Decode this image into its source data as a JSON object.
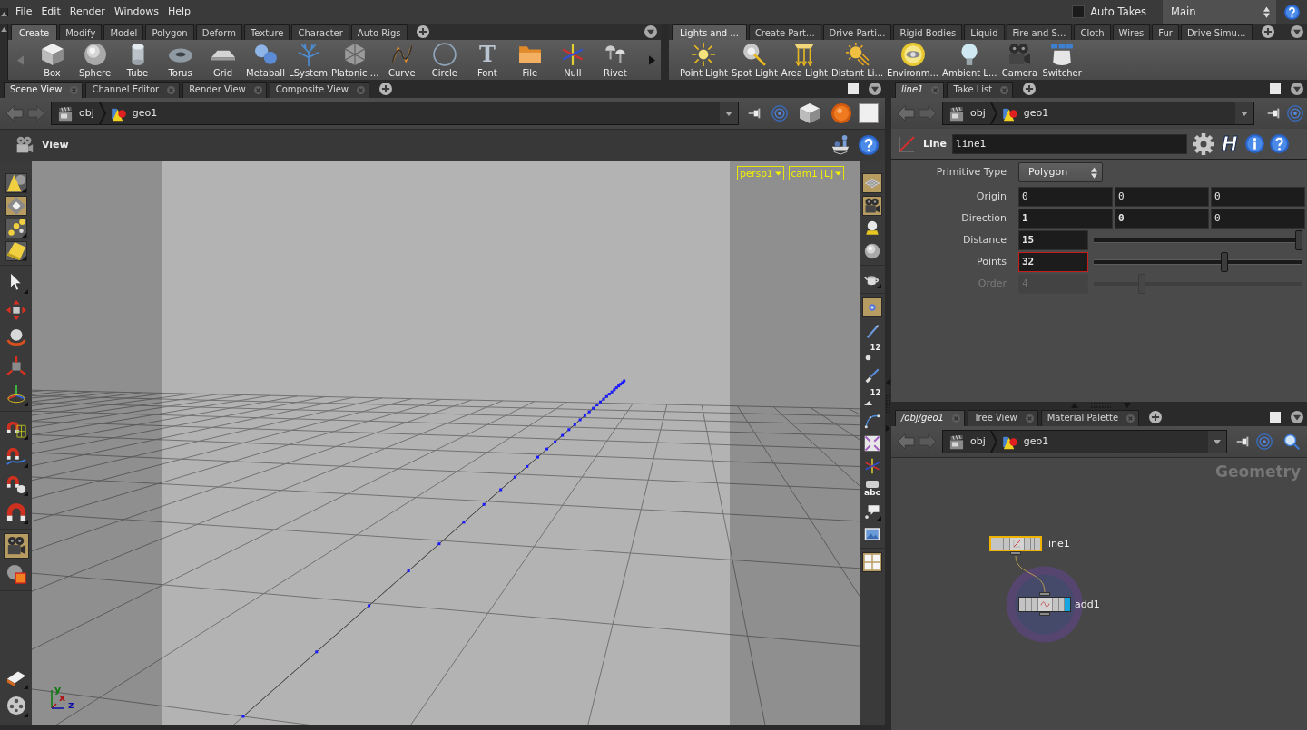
{
  "menu_bar": {
    "items": [
      "File",
      "Edit",
      "Render",
      "Windows",
      "Help"
    ],
    "auto_takes": {
      "label": "Auto Takes",
      "checked": false
    },
    "take": "Main"
  },
  "shelves": [
    {
      "scrollable": true,
      "tabs": [
        {
          "label": "Create",
          "selected": true
        },
        {
          "label": "Modify",
          "selected": false
        },
        {
          "label": "Model",
          "selected": false
        },
        {
          "label": "Polygon",
          "selected": false
        },
        {
          "label": "Deform",
          "selected": false
        },
        {
          "label": "Texture",
          "selected": false
        },
        {
          "label": "Character",
          "selected": false
        },
        {
          "label": "Auto Rigs",
          "selected": false
        }
      ],
      "tools": [
        {
          "label": "Box",
          "kind": "cube"
        },
        {
          "label": "Sphere",
          "kind": "sphere"
        },
        {
          "label": "Tube",
          "kind": "cylinder"
        },
        {
          "label": "Torus",
          "kind": "torus"
        },
        {
          "label": "Grid",
          "kind": "plane"
        },
        {
          "label": "Metaball",
          "kind": "blobs"
        },
        {
          "label": "LSystem",
          "kind": "tree"
        },
        {
          "label": "Platonic ...",
          "kind": "polyhedron"
        },
        {
          "label": "Curve",
          "kind": "curve"
        },
        {
          "label": "Circle",
          "kind": "ring"
        },
        {
          "label": "Font",
          "kind": "glyph",
          "glyph": "T"
        },
        {
          "label": "File",
          "kind": "folder"
        },
        {
          "label": "Null",
          "kind": "axes"
        },
        {
          "label": "Rivet",
          "kind": "bolts"
        }
      ]
    },
    {
      "scrollable": false,
      "tabs": [
        {
          "label": "Lights and ...",
          "selected": true
        },
        {
          "label": "Create Part...",
          "selected": false
        },
        {
          "label": "Drive Parti...",
          "selected": false
        },
        {
          "label": "Rigid Bodies",
          "selected": false
        },
        {
          "label": "Liquid",
          "selected": false
        },
        {
          "label": "Fire and S...",
          "selected": false
        },
        {
          "label": "Cloth",
          "selected": false
        },
        {
          "label": "Wires",
          "selected": false
        },
        {
          "label": "Fur",
          "selected": false
        },
        {
          "label": "Drive Simu...",
          "selected": false
        }
      ],
      "tools": [
        {
          "label": "Point Light",
          "kind": "starburst"
        },
        {
          "label": "Spot Light",
          "kind": "spotlight"
        },
        {
          "label": "Area Light",
          "kind": "panel"
        },
        {
          "label": "Distant Li...",
          "kind": "sun"
        },
        {
          "label": "Environm...",
          "kind": "disc"
        },
        {
          "label": "Ambient L...",
          "kind": "bulb"
        },
        {
          "label": "Camera",
          "kind": "camera"
        },
        {
          "label": "Switcher",
          "kind": "screens"
        }
      ]
    }
  ],
  "scene_view": {
    "tabs": [
      {
        "label": "Scene View",
        "selected": true,
        "linked": false
      },
      {
        "label": "Channel Editor",
        "selected": false,
        "linked": false
      },
      {
        "label": "Render View",
        "selected": false,
        "linked": false
      },
      {
        "label": "Composite View",
        "selected": false,
        "linked": false
      }
    ],
    "path": [
      {
        "label": "obj",
        "kind": "network"
      },
      {
        "label": "geo1",
        "kind": "geometry"
      }
    ],
    "title": "View",
    "camera_menus": [
      "persp1",
      "cam1 [L]"
    ],
    "left_toolbar": [
      {
        "boxed": true,
        "tools": [
          {
            "kind": "cone",
            "selected": false,
            "has_menu": true
          },
          {
            "kind": "diamond",
            "selected": true,
            "has_menu": false
          },
          {
            "kind": "dots",
            "selected": false,
            "has_menu": true
          },
          {
            "kind": "block",
            "selected": false,
            "has_menu": true
          }
        ]
      },
      {
        "boxed": false,
        "tools": [
          {
            "kind": "arrow",
            "selected": false,
            "has_menu": true
          },
          {
            "kind": "move",
            "selected": false,
            "has_menu": false
          },
          {
            "kind": "rotate",
            "selected": false,
            "has_menu": false
          },
          {
            "kind": "scale",
            "selected": false,
            "has_menu": false
          },
          {
            "kind": "handle",
            "selected": false,
            "has_menu": true
          }
        ]
      },
      {
        "boxed": false,
        "tools": [
          {
            "kind": "snapgrid",
            "selected": false,
            "has_menu": true
          },
          {
            "kind": "snapcurve",
            "selected": false,
            "has_menu": true
          },
          {
            "kind": "snappoint",
            "selected": false,
            "has_menu": true
          },
          {
            "kind": "magnet",
            "selected": false,
            "has_menu": true
          }
        ]
      },
      {
        "boxed": false,
        "tools": [
          {
            "kind": "camera",
            "selected": true,
            "has_menu": false
          },
          {
            "kind": "render",
            "selected": false,
            "has_menu": false
          }
        ]
      },
      {
        "boxed": false,
        "tools": [
          {
            "kind": "notes",
            "selected": false,
            "has_menu": true
          },
          {
            "kind": "reel",
            "selected": false,
            "has_menu": true
          }
        ]
      }
    ],
    "right_toolbar": [
      {
        "boxed": false,
        "tools": [
          {
            "kind": "gridplane",
            "selected": true,
            "has_menu": false
          },
          {
            "kind": "camera",
            "selected": true,
            "has_menu": false
          },
          {
            "kind": "lamp",
            "selected": false,
            "has_menu": false
          },
          {
            "kind": "sphere",
            "selected": false,
            "has_menu": false
          }
        ]
      },
      {
        "boxed": false,
        "tools": [
          {
            "kind": "teapot",
            "selected": false,
            "has_menu": true
          }
        ]
      },
      {
        "boxed": false,
        "tools": [
          {
            "kind": "dot",
            "selected": true,
            "has_menu": false
          },
          {
            "kind": "pen",
            "selected": false,
            "has_menu": false
          },
          {
            "kind": "pointnum",
            "caption": "12",
            "selected": false,
            "has_menu": false
          },
          {
            "kind": "brush",
            "selected": false,
            "has_menu": false
          },
          {
            "kind": "primnum",
            "caption": "12",
            "selected": false,
            "has_menu": false
          },
          {
            "kind": "bezier",
            "selected": false,
            "has_menu": false
          },
          {
            "kind": "shrink",
            "selected": false,
            "has_menu": false
          },
          {
            "kind": "axes",
            "selected": false,
            "has_menu": false
          },
          {
            "kind": "label",
            "caption": "abc",
            "selected": false,
            "has_menu": false
          },
          {
            "kind": "bubble",
            "selected": false,
            "has_menu": true
          },
          {
            "kind": "picture",
            "selected": false,
            "has_menu": false
          }
        ]
      },
      {
        "boxed": false,
        "tools": [
          {
            "kind": "tiles",
            "selected": true,
            "has_menu": false
          }
        ]
      }
    ],
    "axes": [
      {
        "label": "y",
        "color": "#0a780a"
      },
      {
        "label": "x",
        "color": "#b00c0c"
      },
      {
        "label": "z",
        "color": "#0c0ca8"
      }
    ]
  },
  "parameters": {
    "tabs": [
      {
        "label": "line1",
        "selected": true,
        "linked": true
      },
      {
        "label": "Take List",
        "selected": false,
        "linked": false
      }
    ],
    "path": [
      {
        "label": "obj",
        "kind": "network"
      },
      {
        "label": "geo1",
        "kind": "geometry"
      }
    ],
    "node_type": "Line",
    "node_name": "line1",
    "script_button": "H",
    "fields": [
      {
        "kind": "menu",
        "label": "Primitive Type",
        "value": "Polygon",
        "focused": false,
        "disabled": false
      },
      {
        "kind": "vector",
        "label": "Origin",
        "values": [
          {
            "text": "0",
            "changed": false
          },
          {
            "text": "0",
            "changed": false
          },
          {
            "text": "0",
            "changed": false
          }
        ],
        "focused": false,
        "disabled": false
      },
      {
        "kind": "vector",
        "label": "Direction",
        "values": [
          {
            "text": "1",
            "changed": true
          },
          {
            "text": "0",
            "changed": true
          },
          {
            "text": "0",
            "changed": false
          }
        ],
        "focused": false,
        "disabled": false
      },
      {
        "kind": "slider",
        "label": "Distance",
        "value": "15",
        "changed": true,
        "level": 1,
        "focused": false,
        "disabled": false
      },
      {
        "kind": "slider",
        "label": "Points",
        "value": "32",
        "changed": true,
        "level": 0.63,
        "focused": true,
        "disabled": false
      },
      {
        "kind": "slider",
        "label": "Order",
        "value": "4",
        "changed": false,
        "level": 0.22,
        "focused": false,
        "disabled": true
      }
    ]
  },
  "network": {
    "tabs": [
      {
        "label": "/obj/geo1",
        "selected": true,
        "linked": true
      },
      {
        "label": "Tree View",
        "selected": false,
        "linked": false
      },
      {
        "label": "Material Palette",
        "selected": false,
        "linked": false
      }
    ],
    "path": [
      {
        "label": "obj",
        "kind": "network"
      },
      {
        "label": "geo1",
        "kind": "geometry"
      }
    ],
    "context": "Geometry",
    "nodes": [
      {
        "name": "line1",
        "kind": "line",
        "selected": true,
        "display": false,
        "has_input": false
      },
      {
        "name": "add1",
        "kind": "wave",
        "selected": false,
        "display": true,
        "has_input": true
      }
    ]
  }
}
